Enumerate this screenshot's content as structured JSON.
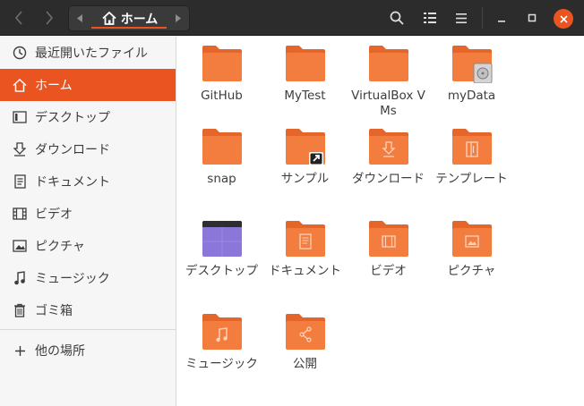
{
  "header": {
    "path": "ホーム"
  },
  "sidebar": {
    "items": [
      {
        "label": "最近開いたファイル",
        "icon": "clock-icon"
      },
      {
        "label": "ホーム",
        "icon": "home-icon",
        "active": true
      },
      {
        "label": "デスクトップ",
        "icon": "desktop-icon"
      },
      {
        "label": "ダウンロード",
        "icon": "download-icon"
      },
      {
        "label": "ドキュメント",
        "icon": "document-icon"
      },
      {
        "label": "ビデオ",
        "icon": "film-icon"
      },
      {
        "label": "ピクチャ",
        "icon": "picture-icon"
      },
      {
        "label": "ミュージック",
        "icon": "music-icon"
      },
      {
        "label": "ゴミ箱",
        "icon": "trash-icon"
      }
    ],
    "other_locations": "他の場所"
  },
  "files": [
    {
      "name": "GitHub"
    },
    {
      "name": "MyTest"
    },
    {
      "name": "VirtualBox VMs"
    },
    {
      "name": "myData"
    },
    {
      "name": "snap"
    },
    {
      "name": "サンプル"
    },
    {
      "name": "ダウンロード"
    },
    {
      "name": "テンプレート"
    },
    {
      "name": "デスクトップ"
    },
    {
      "name": "ドキュメント"
    },
    {
      "name": "ビデオ"
    },
    {
      "name": "ピクチャ"
    },
    {
      "name": "ミュージック"
    },
    {
      "name": "公開"
    }
  ],
  "colors": {
    "accent": "#e95420",
    "folder": "#f27d3f",
    "folder_tab": "#e5662a",
    "header": "#2c2c2c"
  }
}
